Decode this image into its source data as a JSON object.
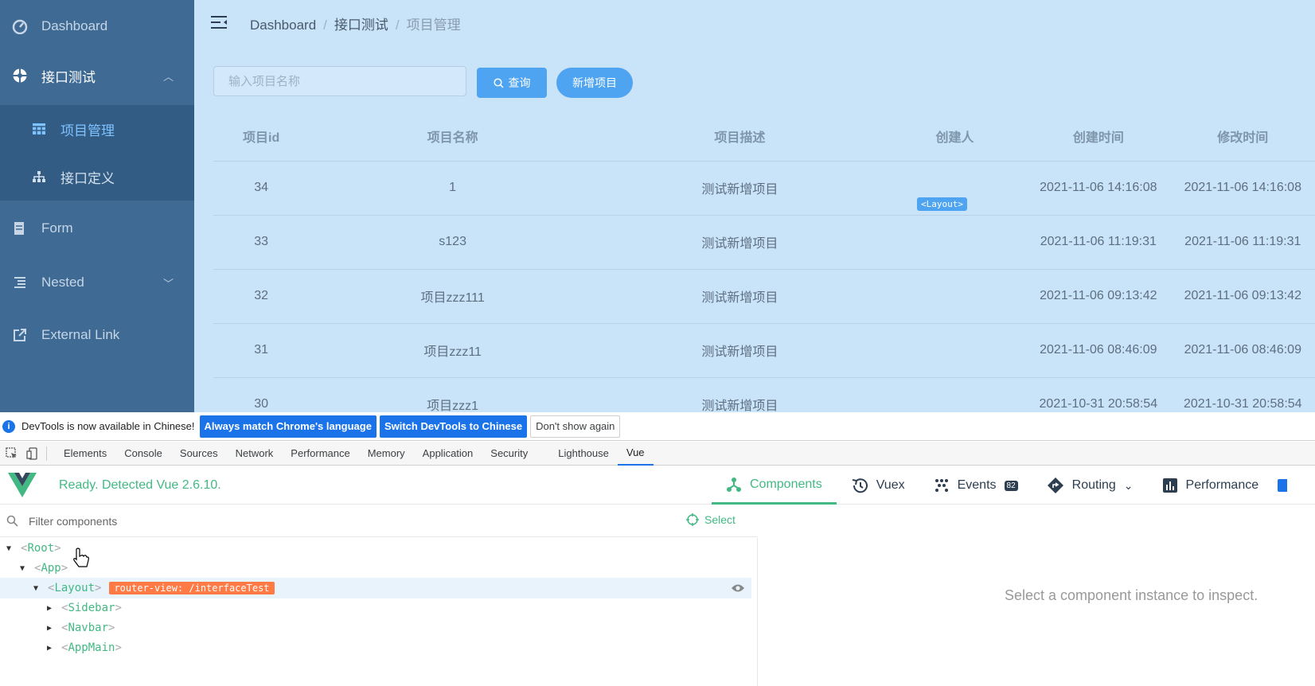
{
  "sidebar": {
    "items": [
      {
        "label": "Dashboard",
        "icon": "dashboard-icon"
      },
      {
        "label": "接口测试",
        "icon": "gear-wheel-icon"
      },
      {
        "label": "Form",
        "icon": "form-icon"
      },
      {
        "label": "Nested",
        "icon": "nested-list-icon"
      },
      {
        "label": "External Link",
        "icon": "external-link-icon"
      }
    ],
    "sub_items": [
      {
        "label": "项目管理",
        "icon": "table-icon"
      },
      {
        "label": "接口定义",
        "icon": "tree-icon"
      }
    ]
  },
  "breadcrumb": {
    "home": "Dashboard",
    "parent": "接口测试",
    "current": "项目管理",
    "separator": "/"
  },
  "search": {
    "placeholder": "输入项目名称",
    "query_label": "查询",
    "add_label": "新增项目"
  },
  "table": {
    "headers": [
      "项目id",
      "项目名称",
      "项目描述",
      "创建人",
      "创建时间",
      "修改时间"
    ],
    "rows": [
      [
        "34",
        "1",
        "测试新增项目",
        "",
        "2021-11-06 14:16:08",
        "2021-11-06 14:16:08"
      ],
      [
        "33",
        "s123",
        "测试新增项目",
        "",
        "2021-11-06 11:19:31",
        "2021-11-06 11:19:31"
      ],
      [
        "32",
        "项目zzz111",
        "测试新增项目",
        "",
        "2021-11-06 09:13:42",
        "2021-11-06 09:13:42"
      ],
      [
        "31",
        "项目zzz11",
        "测试新增项目",
        "",
        "2021-11-06 08:46:09",
        "2021-11-06 08:46:09"
      ],
      [
        "30",
        "项目zzz1",
        "测试新增项目",
        "",
        "2021-10-31 20:58:54",
        "2021-10-31 20:58:54"
      ]
    ],
    "overlay_tag": "<Layout>"
  },
  "devtools": {
    "infobar": {
      "message": "DevTools is now available in Chinese!",
      "btn_match": "Always match Chrome's language",
      "btn_switch": "Switch DevTools to Chinese",
      "btn_dismiss": "Don't show again"
    },
    "tabs": [
      "Elements",
      "Console",
      "Sources",
      "Network",
      "Performance",
      "Memory",
      "Application",
      "Security",
      "Lighthouse",
      "Vue"
    ],
    "vue": {
      "status": "Ready. Detected Vue 2.6.10.",
      "tabs": {
        "components": "Components",
        "vuex": "Vuex",
        "events": "Events",
        "events_count": "82",
        "routing": "Routing",
        "performance": "Performance"
      },
      "filter_placeholder": "Filter components",
      "select_label": "Select",
      "tree": [
        {
          "name": "Root",
          "open": true
        },
        {
          "name": "App",
          "open": true
        },
        {
          "name": "Layout",
          "open": true,
          "badge": "router-view: /interfaceTest"
        },
        {
          "name": "Sidebar",
          "open": false
        },
        {
          "name": "Navbar",
          "open": false
        },
        {
          "name": "AppMain",
          "open": false
        }
      ],
      "inspect_message": "Select a component instance to inspect."
    }
  },
  "colors": {
    "sidebar": "#3f6a94",
    "accent": "#4ea4f0",
    "vue_green": "#42b983",
    "badge_orange": "#ff7a45"
  }
}
